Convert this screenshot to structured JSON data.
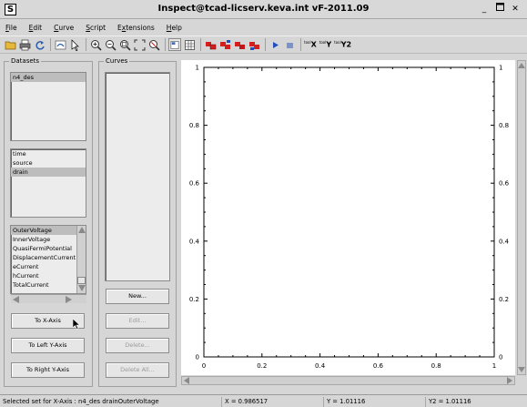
{
  "window": {
    "title": "Inspect@tcad-licserv.keva.int vF-2011.09",
    "app_icon": "S"
  },
  "menu": [
    {
      "pre": "",
      "u": "F",
      "post": "ile"
    },
    {
      "pre": "",
      "u": "E",
      "post": "dit"
    },
    {
      "pre": "",
      "u": "C",
      "post": "urve"
    },
    {
      "pre": "",
      "u": "S",
      "post": "cript"
    },
    {
      "pre": "E",
      "u": "x",
      "post": "tensions"
    },
    {
      "pre": "",
      "u": "H",
      "post": "elp"
    }
  ],
  "toolbar": {
    "x_label": "X",
    "y_label": "Y",
    "y2_label": "Y2",
    "sup_label": "tool"
  },
  "datasets": {
    "label": "Datasets",
    "files": [
      "n4_des"
    ],
    "groups": [
      "time",
      "source",
      "drain"
    ],
    "quantities": [
      "OuterVoltage",
      "InnerVoltage",
      "QuasiFermiPotential",
      "DisplacementCurrent",
      "eCurrent",
      "hCurrent",
      "TotalCurrent"
    ]
  },
  "curves": {
    "label": "Curves"
  },
  "buttons": {
    "to_x": "To X-Axis",
    "to_left_y": "To Left Y-Axis",
    "to_right_y": "To Right Y-Axis",
    "new": "New...",
    "edit": "Edit...",
    "delete": "Delete...",
    "delete_all": "Delete All..."
  },
  "chart_data": {
    "type": "line",
    "series": [],
    "xlim": [
      0,
      1
    ],
    "ylim": [
      0,
      1
    ],
    "y2lim": [
      0,
      1
    ],
    "xticks": [
      "0",
      "0.2",
      "0.4",
      "0.6",
      "0.8",
      "1"
    ],
    "yticks": [
      "0",
      "0.2",
      "0.4",
      "0.6",
      "0.8",
      "1"
    ],
    "y2ticks": [
      "0",
      "0.2",
      "0.4",
      "0.6",
      "0.8",
      "1"
    ],
    "grid": false
  },
  "status": {
    "message": "Selected set for X-Axis : n4_des drainOuterVoltage",
    "x": "X = 0.986517",
    "y": "Y = 1.01116",
    "y2": "Y2 = 1.01116"
  }
}
